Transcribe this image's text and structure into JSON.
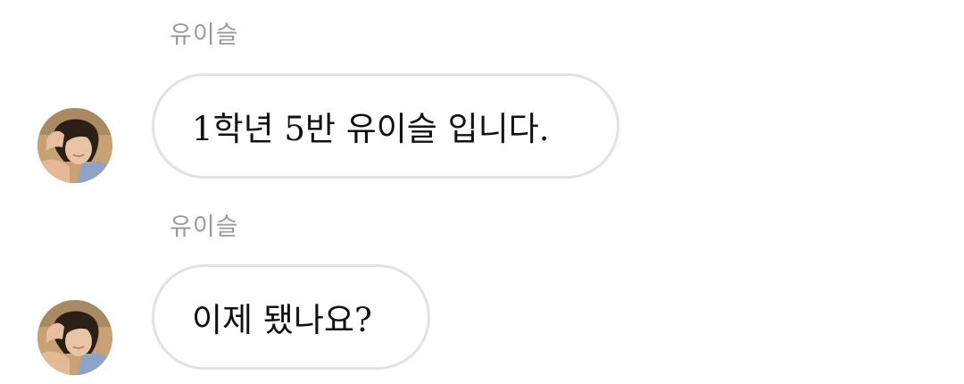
{
  "chat": {
    "messages": [
      {
        "sender": "유이슬",
        "text": "1학년 5반 유이슬 입니다.",
        "avatar_icon": "profile-photo-avatar"
      },
      {
        "sender": "유이슬",
        "text": "이제 됐나요?",
        "avatar_icon": "profile-photo-avatar"
      }
    ]
  },
  "colors": {
    "sender_name": "#9a9a9a",
    "bubble_border": "#e2e2e2",
    "bubble_background": "#ffffff",
    "message_text": "#111111"
  }
}
